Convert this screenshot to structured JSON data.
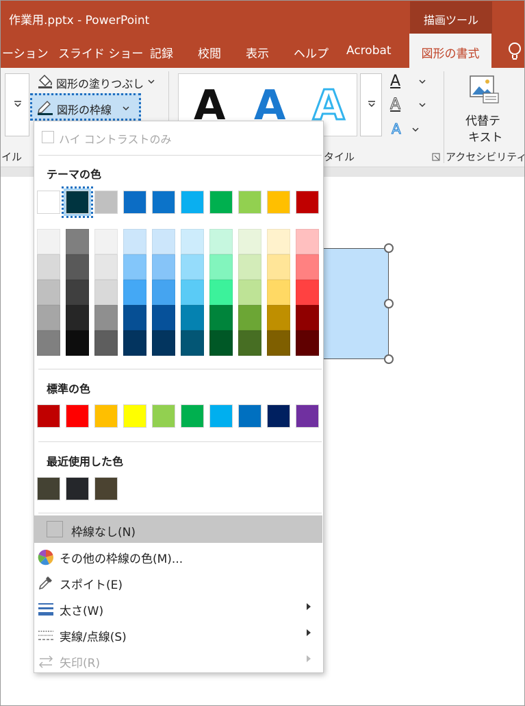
{
  "window": {
    "title": "作業用.pptx  -  PowerPoint",
    "tools_label": "描画ツール"
  },
  "tabs": [
    {
      "label": "ーション"
    },
    {
      "label": "スライド ショー"
    },
    {
      "label": "記録"
    },
    {
      "label": "校閲"
    },
    {
      "label": "表示"
    },
    {
      "label": "ヘルプ"
    },
    {
      "label": "Acrobat"
    }
  ],
  "active_tab": "図形の書式",
  "ribbon": {
    "shape_fill_label": "図形の塗りつぶし",
    "shape_outline_label": "図形の枠線",
    "group_style_left": "イル",
    "group_wordart_style": "タイル",
    "alt_text_line1": "代替テ",
    "alt_text_line2": "キスト",
    "group_accessibility": "アクセシビリティ",
    "wordart_letter": "A"
  },
  "menu": {
    "high_contrast_label": "ハイ コントラストのみ",
    "theme_colors_title": "テーマの色",
    "standard_colors_title": "標準の色",
    "recent_colors_title": "最近使用した色",
    "theme_top": [
      "#ffffff",
      "#003440",
      "#c0c0c0",
      "#0c6dc5",
      "#0c73c9",
      "#0aaff0",
      "#00b04f",
      "#92d050",
      "#ffbf00",
      "#c00000"
    ],
    "theme_shades": [
      [
        "#f2f2f2",
        "#d9d9d9",
        "#bfbfbf",
        "#a6a6a6",
        "#808080"
      ],
      [
        "#7f7f7f",
        "#595959",
        "#3f3f3f",
        "#262626",
        "#0d0d0d"
      ],
      [
        "#f2f2f2",
        "#e6e6e6",
        "#d9d9d9",
        "#8f8f8f",
        "#5e5e5e"
      ],
      [
        "#cce6fb",
        "#83c6fa",
        "#44a8f5",
        "#064f94",
        "#03345f"
      ],
      [
        "#cce6fb",
        "#86c4f8",
        "#45a4f0",
        "#06519a",
        "#03355f"
      ],
      [
        "#cdecfc",
        "#95dcfb",
        "#5acbf6",
        "#0582b1",
        "#035675"
      ],
      [
        "#c6f7df",
        "#82f5bd",
        "#3cf29b",
        "#00843b",
        "#005826"
      ],
      [
        "#e9f5dc",
        "#d3ecb9",
        "#bee396",
        "#6ca635",
        "#476e23"
      ],
      [
        "#fff2cc",
        "#ffe598",
        "#ffd964",
        "#bf8f00",
        "#7f5f00"
      ],
      [
        "#ffbfbf",
        "#ff8181",
        "#ff4141",
        "#900000",
        "#600000"
      ]
    ],
    "standard": [
      "#c00000",
      "#ff0000",
      "#ffbf00",
      "#ffff00",
      "#92d050",
      "#00b04f",
      "#00afef",
      "#0070c0",
      "#002060",
      "#7030a0"
    ],
    "recent": [
      "#444233",
      "#25272b",
      "#4b4331"
    ],
    "items": [
      {
        "label": "枠線なし(N)"
      },
      {
        "label": "その他の枠線の色(M)..."
      },
      {
        "label": "スポイト(E)"
      },
      {
        "label": "太さ(W)"
      },
      {
        "label": "実線/点線(S)"
      },
      {
        "label": "矢印(R)"
      }
    ]
  }
}
